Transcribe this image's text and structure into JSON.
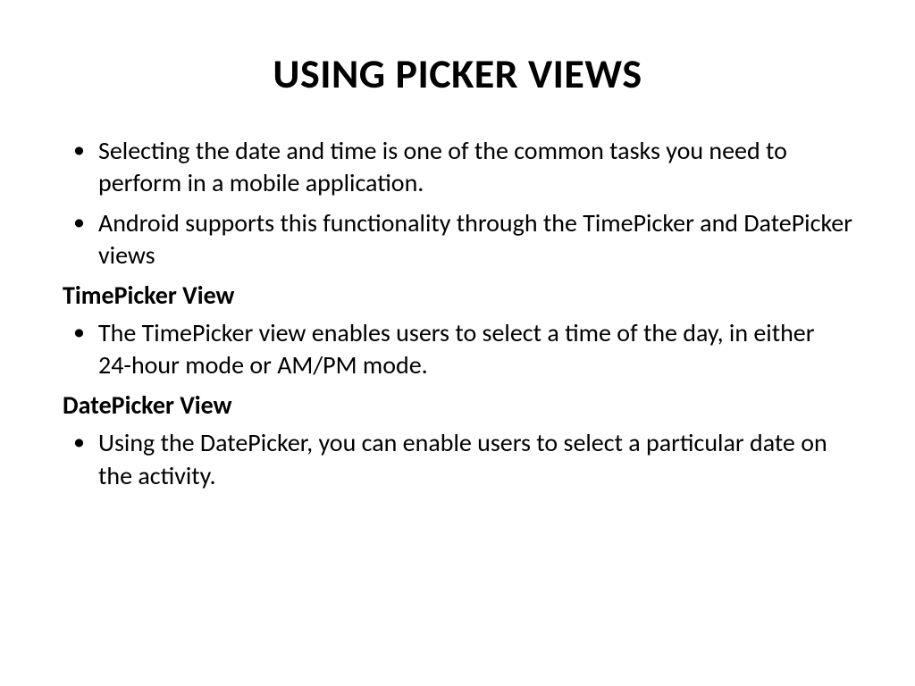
{
  "slide": {
    "title": "USING PICKER VIEWS",
    "bullets": {
      "b1": "Selecting the date and time is one of the common tasks you need to perform in a mobile application.",
      "b2": "Android supports this functionality through the TimePicker and DatePicker views",
      "h1": "TimePicker View",
      "b3": "The TimePicker view enables users to select a time of the day, in either 24-hour mode or AM/PM mode.",
      "h2": "DatePicker View",
      "b4": "Using the DatePicker, you can enable users to select a particular date on the activity."
    }
  }
}
